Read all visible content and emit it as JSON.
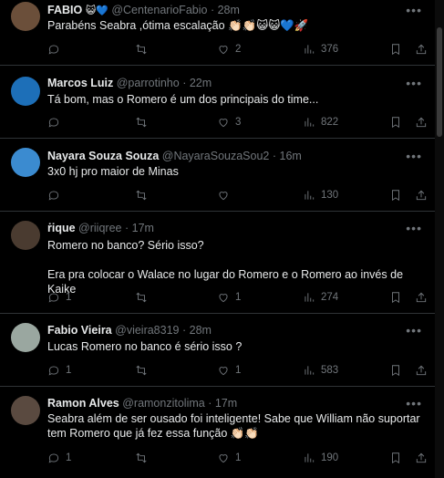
{
  "tweets": [
    {
      "name": "FABIO",
      "badges": "😺💙",
      "handle": "@CentenarioFabio",
      "time": "28m",
      "text": "Parabéns Seabra ,ótima escalação 👏🏻👏🏻😺😺💙🚀",
      "replies": "",
      "retweets": "",
      "likes": "2",
      "views": "376",
      "avatar_color": "#6b4f3a"
    },
    {
      "name": "Marcos Luiz",
      "badges": "",
      "handle": "@parrotinho",
      "time": "22m",
      "text": "Tá bom, mas o Romero é um dos principais do time...",
      "replies": "",
      "retweets": "",
      "likes": "3",
      "views": "822",
      "avatar_color": "#1d6fb8"
    },
    {
      "name": "Nayara Souza Souza",
      "badges": "",
      "handle": "@NayaraSouzaSou2",
      "time": "16m",
      "text": "3x0 hj pro maior de Minas",
      "replies": "",
      "retweets": "",
      "likes": "",
      "views": "130",
      "avatar_color": "#3b8bd0"
    },
    {
      "name": "ṙique",
      "badges": "",
      "handle": "@riiqree",
      "time": "17m",
      "text": "Romero no banco? Sério isso?\n\nEra pra colocar o Walace no lugar do Romero e o Romero ao invés de Kaike",
      "replies": "1",
      "retweets": "",
      "likes": "1",
      "views": "274",
      "avatar_color": "#4a3b30"
    },
    {
      "name": "Fabio Vieira",
      "badges": "",
      "handle": "@vieira8319",
      "time": "28m",
      "text": "Lucas Romero no banco é sério isso ?",
      "replies": "1",
      "retweets": "",
      "likes": "1",
      "views": "583",
      "avatar_color": "#9aa7a0"
    },
    {
      "name": "Ramon Alves",
      "badges": "",
      "handle": "@ramonzitolima",
      "time": "17m",
      "text": "Seabra além de ser ousado foi inteligente! Sabe que William não suportar tem Romero que já fez essa função 👏🏻👏🏻",
      "replies": "1",
      "retweets": "",
      "likes": "1",
      "views": "190",
      "avatar_color": "#5a4a40"
    }
  ],
  "more_icon": "•••",
  "icons": [
    "reply-icon",
    "retweet-icon",
    "like-icon",
    "views-icon",
    "bookmark-icon",
    "share-icon"
  ]
}
